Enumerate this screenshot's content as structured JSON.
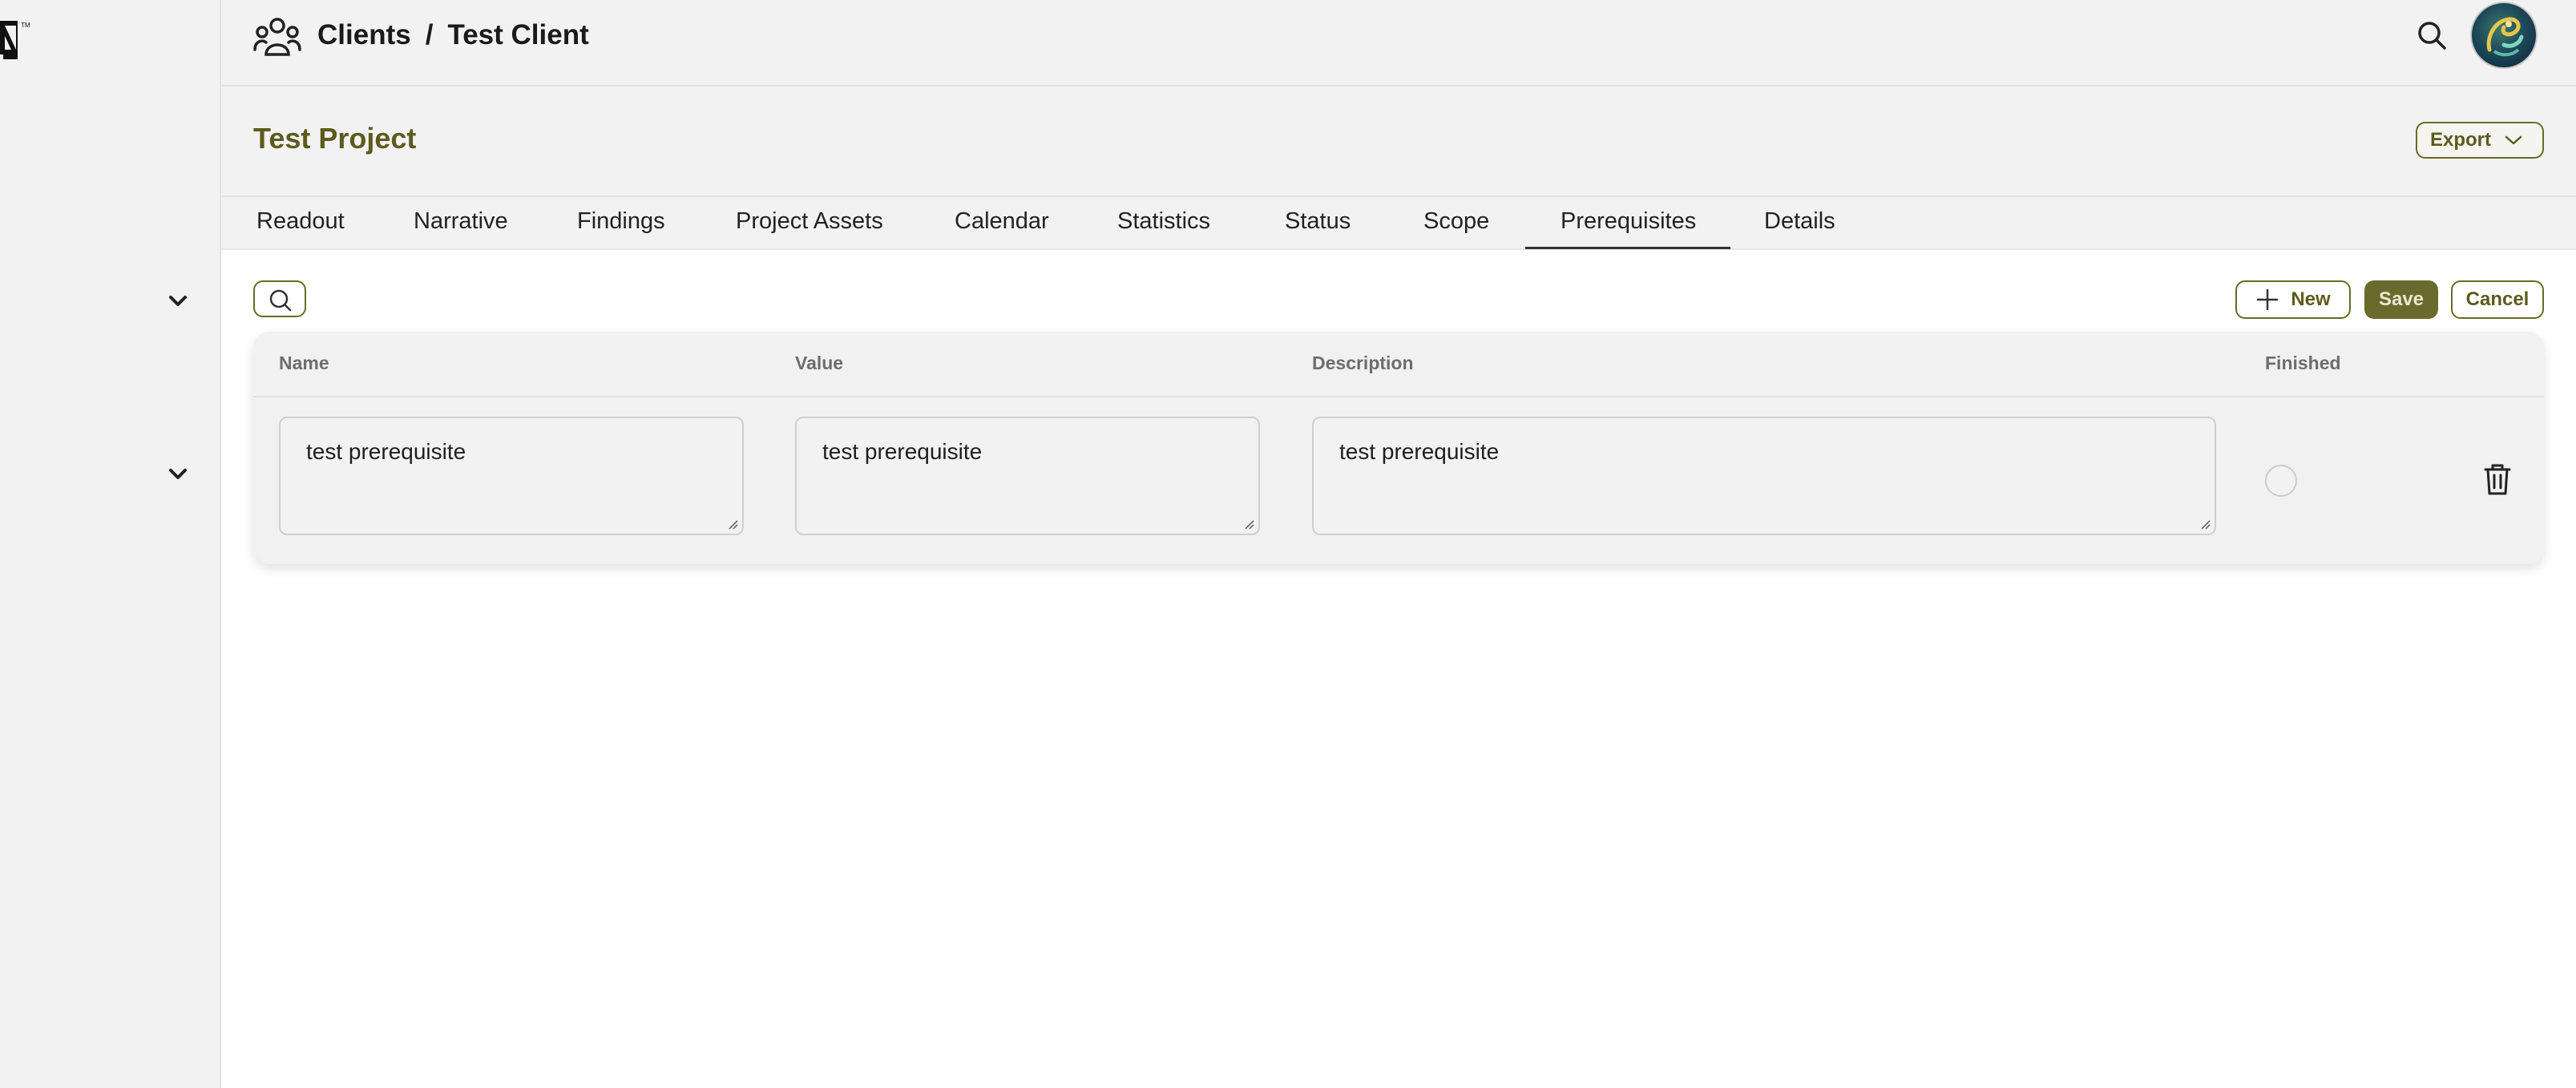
{
  "header": {
    "breadcrumb": [
      "Clients",
      "Test Client"
    ],
    "separator": "/"
  },
  "project": {
    "title": "Test Project",
    "export_label": "Export"
  },
  "tabs": [
    {
      "label": "Readout",
      "active": false
    },
    {
      "label": "Narrative",
      "active": false
    },
    {
      "label": "Findings",
      "active": false
    },
    {
      "label": "Project Assets",
      "active": false
    },
    {
      "label": "Calendar",
      "active": false
    },
    {
      "label": "Statistics",
      "active": false
    },
    {
      "label": "Status",
      "active": false
    },
    {
      "label": "Scope",
      "active": false
    },
    {
      "label": "Prerequisites",
      "active": true
    },
    {
      "label": "Details",
      "active": false
    }
  ],
  "toolbar": {
    "new_label": "New",
    "save_label": "Save",
    "cancel_label": "Cancel"
  },
  "table": {
    "columns": [
      "Name",
      "Value",
      "Description",
      "Finished"
    ],
    "rows": [
      {
        "name": "test prerequisite",
        "value": "test prerequisite",
        "description": "test prerequisite",
        "finished": false
      }
    ]
  },
  "colors": {
    "accent": "#6b6a24",
    "title": "#5e5a1e",
    "save_bg": "#6b6a2e"
  },
  "icons": [
    "logo",
    "chevron-down-icon",
    "users-group-icon",
    "search-icon",
    "avatar",
    "plus-icon",
    "trash-icon"
  ]
}
